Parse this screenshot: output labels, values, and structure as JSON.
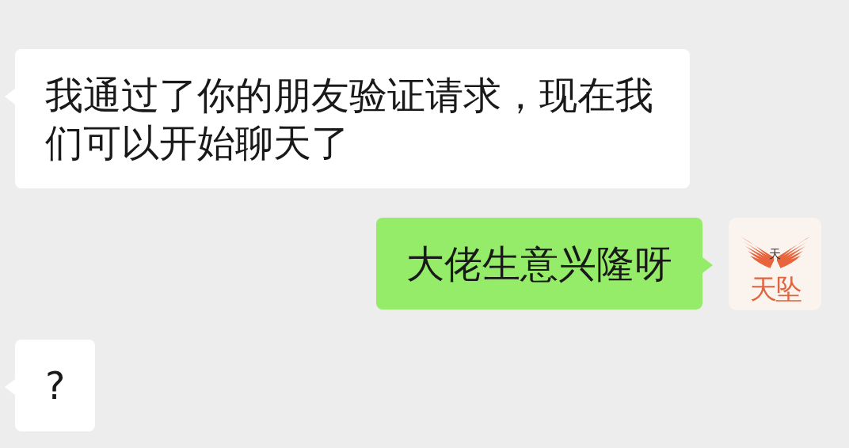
{
  "messages": [
    {
      "kind": "incoming",
      "text": "我通过了你的朋友验证请求，现在我们可以开始聊天了"
    },
    {
      "kind": "outgoing",
      "text": "大佬生意兴隆呀",
      "avatar": {
        "emblem": "天",
        "name": "天坠"
      }
    },
    {
      "kind": "incoming",
      "text": "?"
    }
  ]
}
